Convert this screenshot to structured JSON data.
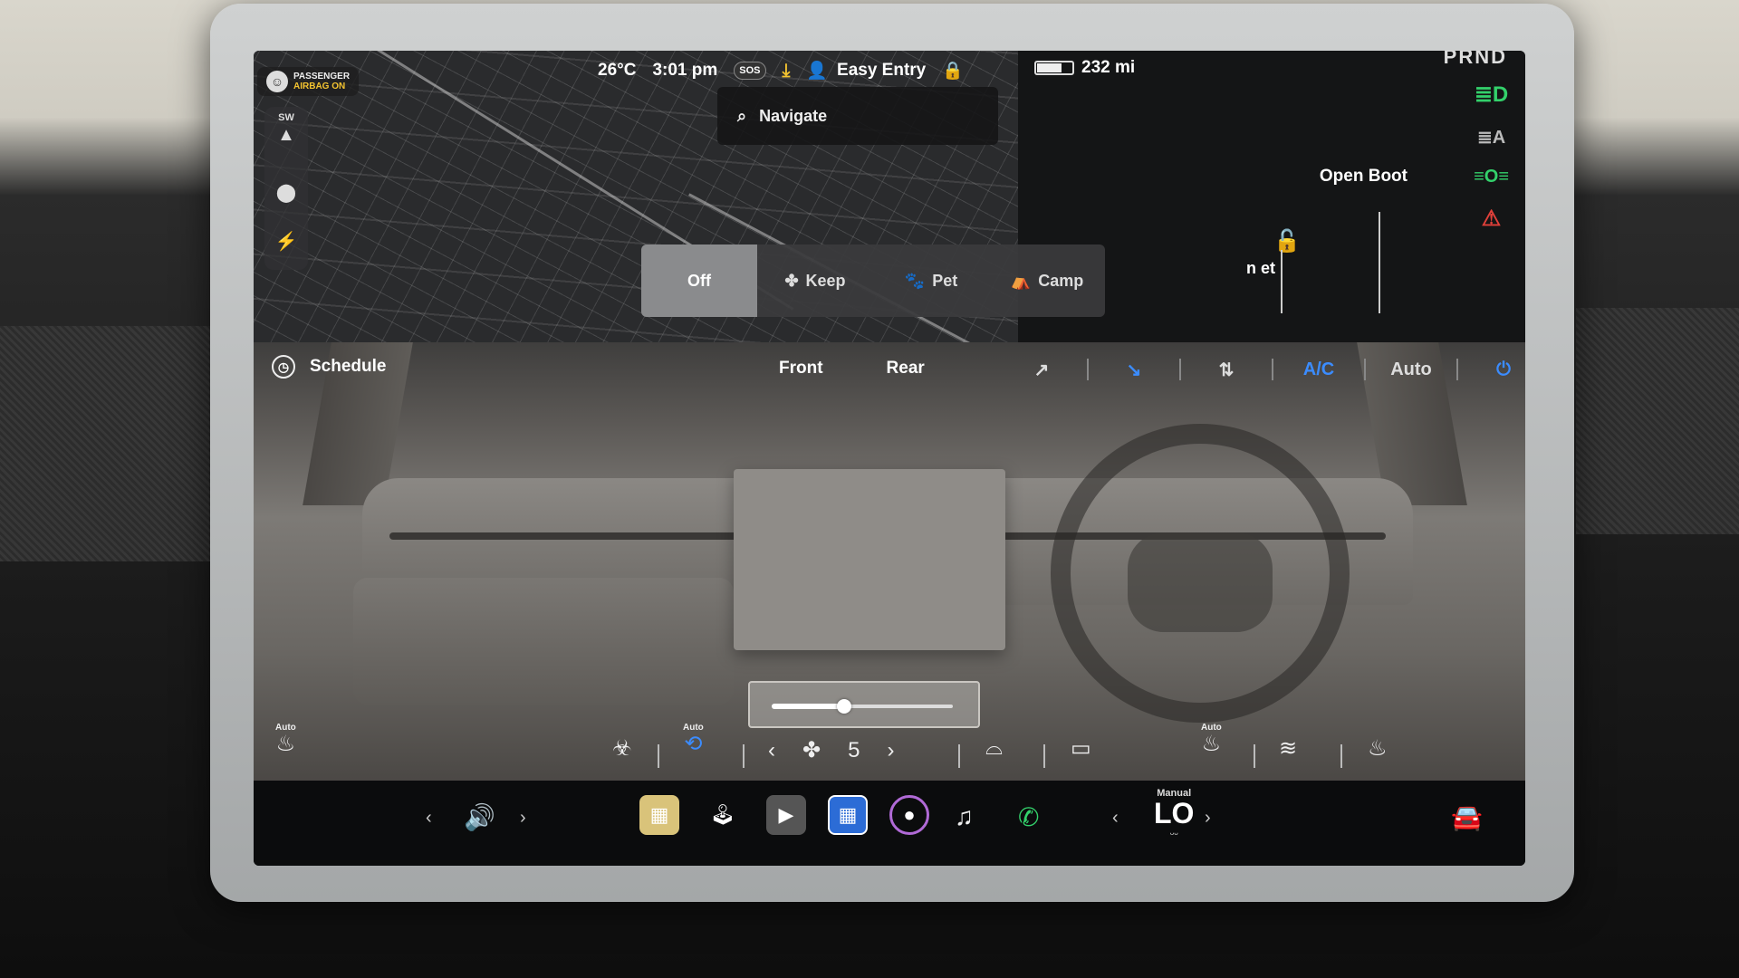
{
  "status": {
    "airbag_line1": "PASSENGER",
    "airbag_line2": "AIRBAG ON",
    "temperature": "26°C",
    "time": "3:01 pm",
    "sos": "SOS",
    "profile": "Easy Entry",
    "range": "232 mi",
    "battery_level": 0.7
  },
  "map": {
    "search_placeholder": "Navigate",
    "compass": "SW"
  },
  "gear": "PRND",
  "vehicle": {
    "open_boot": "Open Boot",
    "frunk_partial": "n et"
  },
  "modes": {
    "off": "Off",
    "keep": "Keep",
    "pet": "Pet",
    "camp": "Camp",
    "active": "off"
  },
  "climate": {
    "schedule": "Schedule",
    "front": "Front",
    "rear": "Rear",
    "ac": "A/C",
    "auto": "Auto",
    "fan_speed": "5",
    "auto_label": "Auto",
    "temp_slider_level": 0.4
  },
  "taskbar": {
    "cabin_temp_mode": "Manual",
    "cabin_temp": "LO"
  },
  "colors": {
    "accent_blue": "#3b8cff",
    "green": "#33d16b",
    "warning_yellow": "#f4c430",
    "red": "#e0403a"
  }
}
